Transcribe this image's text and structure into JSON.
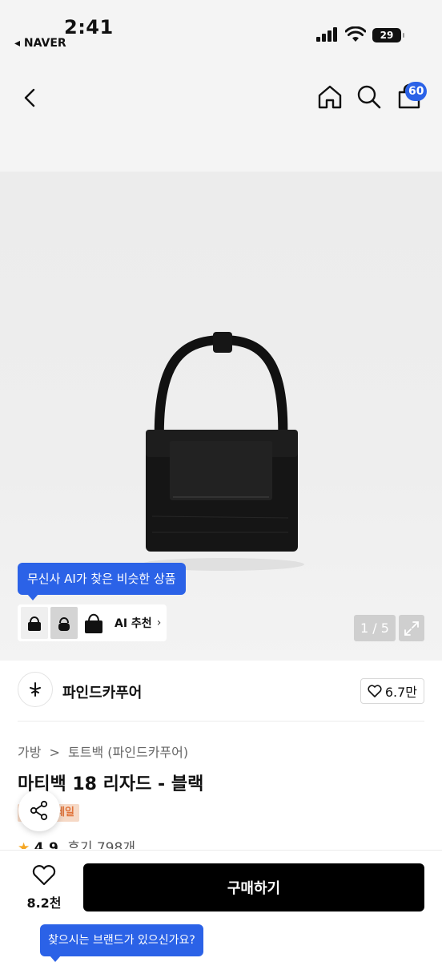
{
  "status_bar": {
    "time": "2:41",
    "back_app": "◂ NAVER",
    "battery": "29"
  },
  "header": {
    "icons": [
      "back-icon",
      "home-icon",
      "search-icon",
      "cart-icon"
    ],
    "cart_badge": "60"
  },
  "gallery": {
    "ai_tooltip": "무신사 AI가 찾은 비슷한 상품",
    "ai_label": "AI 추천",
    "ai_chevron": "›",
    "counter": "1 / 5"
  },
  "brand": {
    "name": "파인드카푸어",
    "likes": "6.7만"
  },
  "product": {
    "breadcrumb": [
      "가방",
      ">",
      "토트백 (파인드카푸어)"
    ],
    "title": "마티백 18 리자드 - 블랙",
    "sale_tag": "세일",
    "rating_star": "★",
    "rating": "4.9",
    "reviews": "후기 798개"
  },
  "bottom_bar": {
    "wish_count": "8.2천",
    "buy_label": "구매하기",
    "brand_tooltip": "찾으시는 브랜드가 있으신가요?"
  },
  "colors": {
    "accent": "#2b62e7",
    "buy_button": "#000000",
    "star": "#f5a623",
    "sale_tag_bg": "#f6d9c6",
    "sale_tag_text": "#e0733a"
  }
}
